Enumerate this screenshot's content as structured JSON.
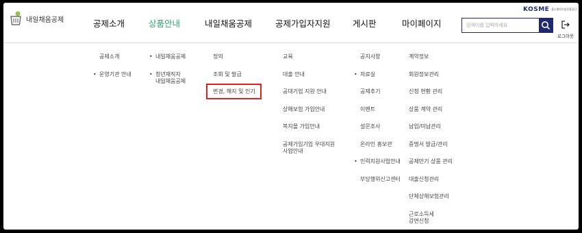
{
  "brand": {
    "name": "내일채움공제",
    "org_logo": "KOSME",
    "org_sub": "중소벤처기업진흥공단"
  },
  "nav": [
    {
      "label": "공제소개",
      "active": false
    },
    {
      "label": "상품안내",
      "active": true
    },
    {
      "label": "내일채움공제",
      "active": false
    },
    {
      "label": "공제가입자지원",
      "active": false
    },
    {
      "label": "게시판",
      "active": false
    },
    {
      "label": "마이페이지",
      "active": false
    }
  ],
  "search": {
    "placeholder": "검색어를 입력하세요",
    "icon": "search-icon"
  },
  "logout": {
    "label": "로그아웃",
    "icon": "logout-icon"
  },
  "colors": {
    "accent_green": "#2aa86b",
    "navy": "#1f2a6e",
    "highlight_red": "#d22222"
  },
  "menu": {
    "col1": [
      "공제소개",
      "운영기관 안내"
    ],
    "col2": [
      "내일채움공제",
      "청년재직자",
      "내일채움공제"
    ],
    "col3": [
      "정의",
      "조회 및 발급",
      "변경, 해지 및 인기"
    ],
    "col4": [
      "교육",
      "대출 안내",
      "공대기업 지원 안내",
      "상해보험 가입안내",
      "복지몰 가입안내",
      "공제가입기업 우대지원",
      "사업안내"
    ],
    "col5": [
      "공지사항",
      "자료실",
      "공제추기",
      "이벤트",
      "설문조사",
      "온라인 홍보관",
      "인력지원사업안내",
      "부당행위신고센터"
    ],
    "col6": [
      "계약정보",
      "회원정보관리",
      "신청 현황 관리",
      "상품 계약 관리",
      "납입/미납관리",
      "증명서 발급/관리",
      "공제만기 상품 관리",
      "대출신청관리",
      "단체상해보험관리",
      "근로소득세",
      "감면신청"
    ]
  }
}
